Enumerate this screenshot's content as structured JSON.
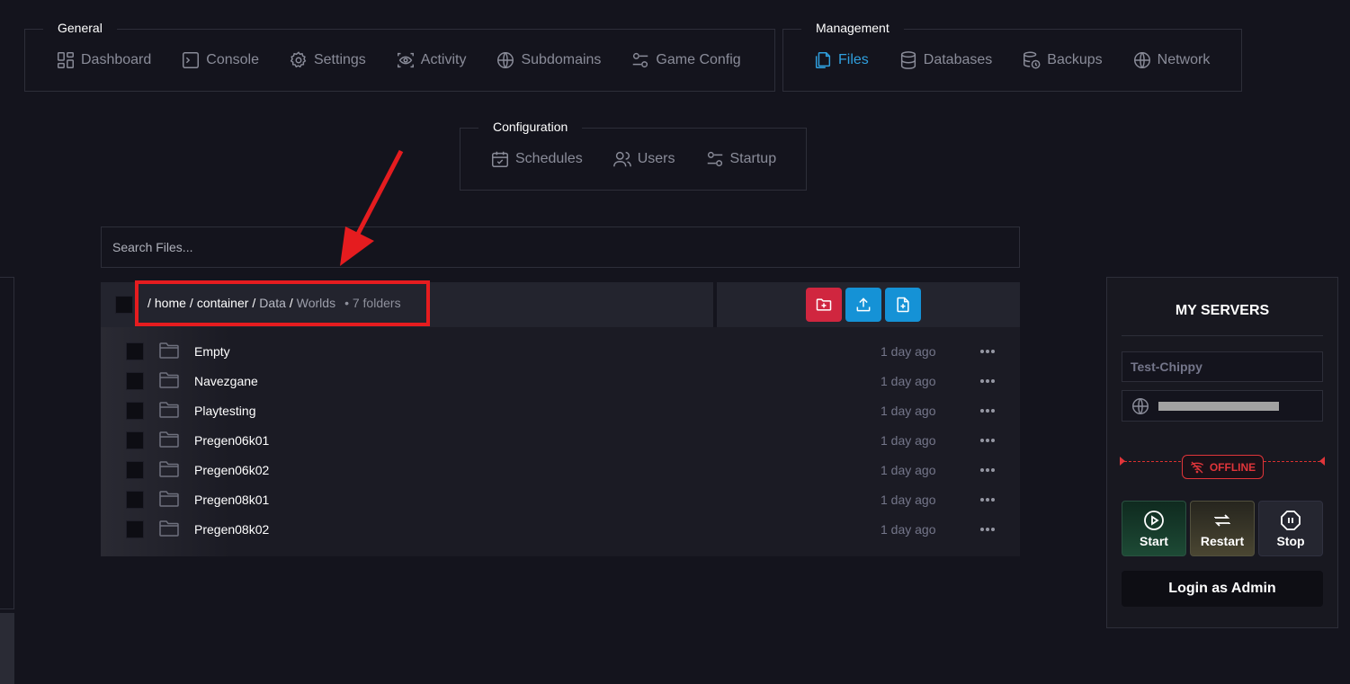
{
  "nav": {
    "general": {
      "title": "General",
      "items": [
        {
          "label": "Dashboard",
          "icon": "dashboard-icon"
        },
        {
          "label": "Console",
          "icon": "console-icon"
        },
        {
          "label": "Settings",
          "icon": "gear-icon"
        },
        {
          "label": "Activity",
          "icon": "activity-icon"
        },
        {
          "label": "Subdomains",
          "icon": "globe-icon"
        },
        {
          "label": "Game Config",
          "icon": "sliders-icon"
        }
      ]
    },
    "management": {
      "title": "Management",
      "items": [
        {
          "label": "Files",
          "icon": "files-icon",
          "active": true
        },
        {
          "label": "Databases",
          "icon": "database-icon"
        },
        {
          "label": "Backups",
          "icon": "backup-icon"
        },
        {
          "label": "Network",
          "icon": "globe-icon"
        }
      ]
    },
    "configuration": {
      "title": "Configuration",
      "items": [
        {
          "label": "Schedules",
          "icon": "calendar-icon"
        },
        {
          "label": "Users",
          "icon": "users-icon"
        },
        {
          "label": "Startup",
          "icon": "sliders-icon"
        }
      ]
    }
  },
  "search": {
    "placeholder": "Search Files..."
  },
  "breadcrumb": {
    "segments": [
      "home",
      "container",
      "Data",
      "Worlds"
    ],
    "separator": "/",
    "count": "• 7 folders"
  },
  "actions": {
    "colors": {
      "new_folder": "#d0263f",
      "upload": "#1592d6",
      "new_file": "#1592d6"
    }
  },
  "files": [
    {
      "name": "Empty",
      "modified": "1 day ago"
    },
    {
      "name": "Navezgane",
      "modified": "1 day ago"
    },
    {
      "name": "Playtesting",
      "modified": "1 day ago"
    },
    {
      "name": "Pregen06k01",
      "modified": "1 day ago"
    },
    {
      "name": "Pregen06k02",
      "modified": "1 day ago"
    },
    {
      "name": "Pregen08k01",
      "modified": "1 day ago"
    },
    {
      "name": "Pregen08k02",
      "modified": "1 day ago"
    }
  ],
  "servers": {
    "title": "MY SERVERS",
    "server_name": "Test-Chippy",
    "status": "OFFLINE",
    "buttons": {
      "start": "Start",
      "restart": "Restart",
      "stop": "Stop"
    },
    "login_admin": "Login as Admin"
  }
}
